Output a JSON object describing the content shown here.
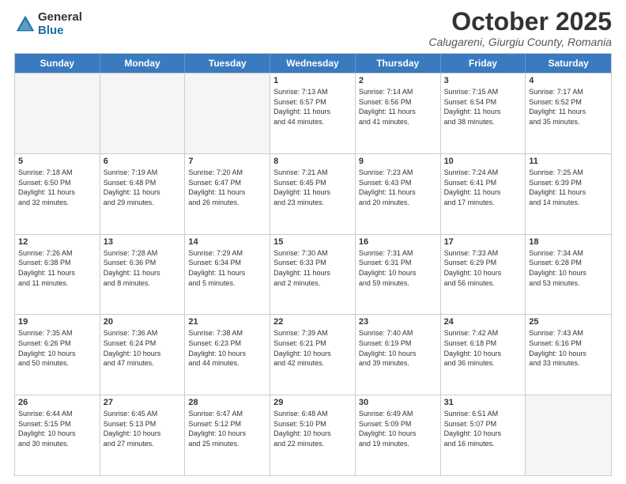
{
  "logo": {
    "general": "General",
    "blue": "Blue"
  },
  "header": {
    "month": "October 2025",
    "location": "Calugareni, Giurgiu County, Romania"
  },
  "days": [
    "Sunday",
    "Monday",
    "Tuesday",
    "Wednesday",
    "Thursday",
    "Friday",
    "Saturday"
  ],
  "weeks": [
    [
      {
        "day": "",
        "text": ""
      },
      {
        "day": "",
        "text": ""
      },
      {
        "day": "",
        "text": ""
      },
      {
        "day": "1",
        "text": "Sunrise: 7:13 AM\nSunset: 6:57 PM\nDaylight: 11 hours\nand 44 minutes."
      },
      {
        "day": "2",
        "text": "Sunrise: 7:14 AM\nSunset: 6:56 PM\nDaylight: 11 hours\nand 41 minutes."
      },
      {
        "day": "3",
        "text": "Sunrise: 7:15 AM\nSunset: 6:54 PM\nDaylight: 11 hours\nand 38 minutes."
      },
      {
        "day": "4",
        "text": "Sunrise: 7:17 AM\nSunset: 6:52 PM\nDaylight: 11 hours\nand 35 minutes."
      }
    ],
    [
      {
        "day": "5",
        "text": "Sunrise: 7:18 AM\nSunset: 6:50 PM\nDaylight: 11 hours\nand 32 minutes."
      },
      {
        "day": "6",
        "text": "Sunrise: 7:19 AM\nSunset: 6:48 PM\nDaylight: 11 hours\nand 29 minutes."
      },
      {
        "day": "7",
        "text": "Sunrise: 7:20 AM\nSunset: 6:47 PM\nDaylight: 11 hours\nand 26 minutes."
      },
      {
        "day": "8",
        "text": "Sunrise: 7:21 AM\nSunset: 6:45 PM\nDaylight: 11 hours\nand 23 minutes."
      },
      {
        "day": "9",
        "text": "Sunrise: 7:23 AM\nSunset: 6:43 PM\nDaylight: 11 hours\nand 20 minutes."
      },
      {
        "day": "10",
        "text": "Sunrise: 7:24 AM\nSunset: 6:41 PM\nDaylight: 11 hours\nand 17 minutes."
      },
      {
        "day": "11",
        "text": "Sunrise: 7:25 AM\nSunset: 6:39 PM\nDaylight: 11 hours\nand 14 minutes."
      }
    ],
    [
      {
        "day": "12",
        "text": "Sunrise: 7:26 AM\nSunset: 6:38 PM\nDaylight: 11 hours\nand 11 minutes."
      },
      {
        "day": "13",
        "text": "Sunrise: 7:28 AM\nSunset: 6:36 PM\nDaylight: 11 hours\nand 8 minutes."
      },
      {
        "day": "14",
        "text": "Sunrise: 7:29 AM\nSunset: 6:34 PM\nDaylight: 11 hours\nand 5 minutes."
      },
      {
        "day": "15",
        "text": "Sunrise: 7:30 AM\nSunset: 6:33 PM\nDaylight: 11 hours\nand 2 minutes."
      },
      {
        "day": "16",
        "text": "Sunrise: 7:31 AM\nSunset: 6:31 PM\nDaylight: 10 hours\nand 59 minutes."
      },
      {
        "day": "17",
        "text": "Sunrise: 7:33 AM\nSunset: 6:29 PM\nDaylight: 10 hours\nand 56 minutes."
      },
      {
        "day": "18",
        "text": "Sunrise: 7:34 AM\nSunset: 6:28 PM\nDaylight: 10 hours\nand 53 minutes."
      }
    ],
    [
      {
        "day": "19",
        "text": "Sunrise: 7:35 AM\nSunset: 6:26 PM\nDaylight: 10 hours\nand 50 minutes."
      },
      {
        "day": "20",
        "text": "Sunrise: 7:36 AM\nSunset: 6:24 PM\nDaylight: 10 hours\nand 47 minutes."
      },
      {
        "day": "21",
        "text": "Sunrise: 7:38 AM\nSunset: 6:23 PM\nDaylight: 10 hours\nand 44 minutes."
      },
      {
        "day": "22",
        "text": "Sunrise: 7:39 AM\nSunset: 6:21 PM\nDaylight: 10 hours\nand 42 minutes."
      },
      {
        "day": "23",
        "text": "Sunrise: 7:40 AM\nSunset: 6:19 PM\nDaylight: 10 hours\nand 39 minutes."
      },
      {
        "day": "24",
        "text": "Sunrise: 7:42 AM\nSunset: 6:18 PM\nDaylight: 10 hours\nand 36 minutes."
      },
      {
        "day": "25",
        "text": "Sunrise: 7:43 AM\nSunset: 6:16 PM\nDaylight: 10 hours\nand 33 minutes."
      }
    ],
    [
      {
        "day": "26",
        "text": "Sunrise: 6:44 AM\nSunset: 5:15 PM\nDaylight: 10 hours\nand 30 minutes."
      },
      {
        "day": "27",
        "text": "Sunrise: 6:45 AM\nSunset: 5:13 PM\nDaylight: 10 hours\nand 27 minutes."
      },
      {
        "day": "28",
        "text": "Sunrise: 6:47 AM\nSunset: 5:12 PM\nDaylight: 10 hours\nand 25 minutes."
      },
      {
        "day": "29",
        "text": "Sunrise: 6:48 AM\nSunset: 5:10 PM\nDaylight: 10 hours\nand 22 minutes."
      },
      {
        "day": "30",
        "text": "Sunrise: 6:49 AM\nSunset: 5:09 PM\nDaylight: 10 hours\nand 19 minutes."
      },
      {
        "day": "31",
        "text": "Sunrise: 6:51 AM\nSunset: 5:07 PM\nDaylight: 10 hours\nand 16 minutes."
      },
      {
        "day": "",
        "text": ""
      }
    ]
  ]
}
